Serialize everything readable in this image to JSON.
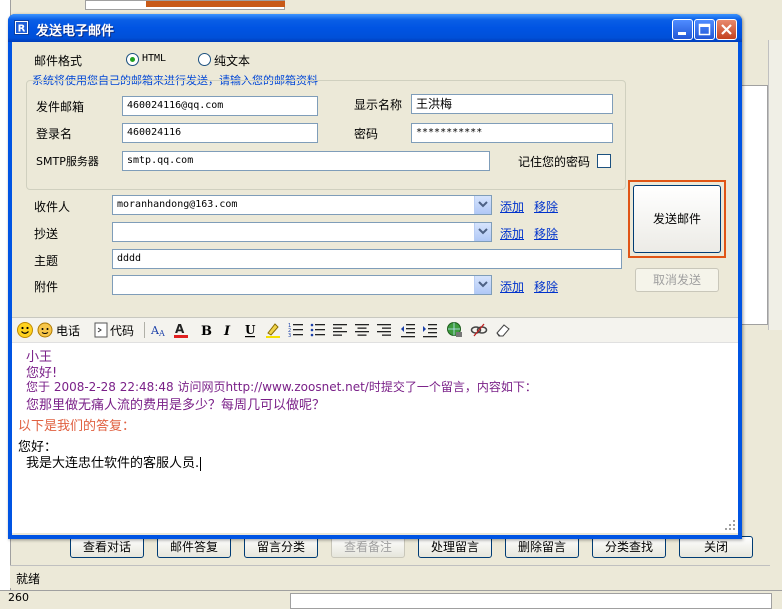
{
  "dialog": {
    "title": "发送电子邮件",
    "format_label": "邮件格式",
    "format_html": "HTML",
    "format_text": "纯文本",
    "note": "系统将使用您自己的邮箱来进行发送，请输入您的邮箱资料",
    "sender_label": "发件邮箱",
    "sender_value": "460024116@qq.com",
    "display_name_label": "显示名称",
    "display_name_value": "王洪梅",
    "login_label": "登录名",
    "login_value": "460024116",
    "password_label": "密码",
    "password_value": "***********",
    "smtp_label": "SMTP服务器",
    "smtp_value": "smtp.qq.com",
    "remember_label": "记住您的密码",
    "to_label": "收件人",
    "to_value": "moranhandong@163.com",
    "cc_label": "抄送",
    "cc_value": "",
    "subject_label": "主题",
    "subject_value": "dddd",
    "attach_label": "附件",
    "attach_value": "",
    "add_link": "添加",
    "remove_link": "移除",
    "send_button": "发送邮件",
    "cancel_button": "取消发送"
  },
  "toolbar": {
    "phone": "电话",
    "code": "代码"
  },
  "editor": {
    "line1": "小王",
    "line2": "您好!",
    "line3": "您于 2008-2-28 22:48:48 访问网页http://www.zoosnet.net/时提交了一个留言，内容如下：",
    "line4": "您那里做无痛人流的费用是多少？每周几可以做呢？",
    "line5": "以下是我们的答复：",
    "line6": "您好：",
    "line7": "我是大连忠仕软件的客服人员."
  },
  "background": {
    "buttons": [
      "查看对话",
      "邮件答复",
      "留言分类",
      "查看备注",
      "处理留言",
      "删除留言",
      "分类查找",
      "关闭"
    ],
    "status": "就绪",
    "bottom_value": "260"
  }
}
